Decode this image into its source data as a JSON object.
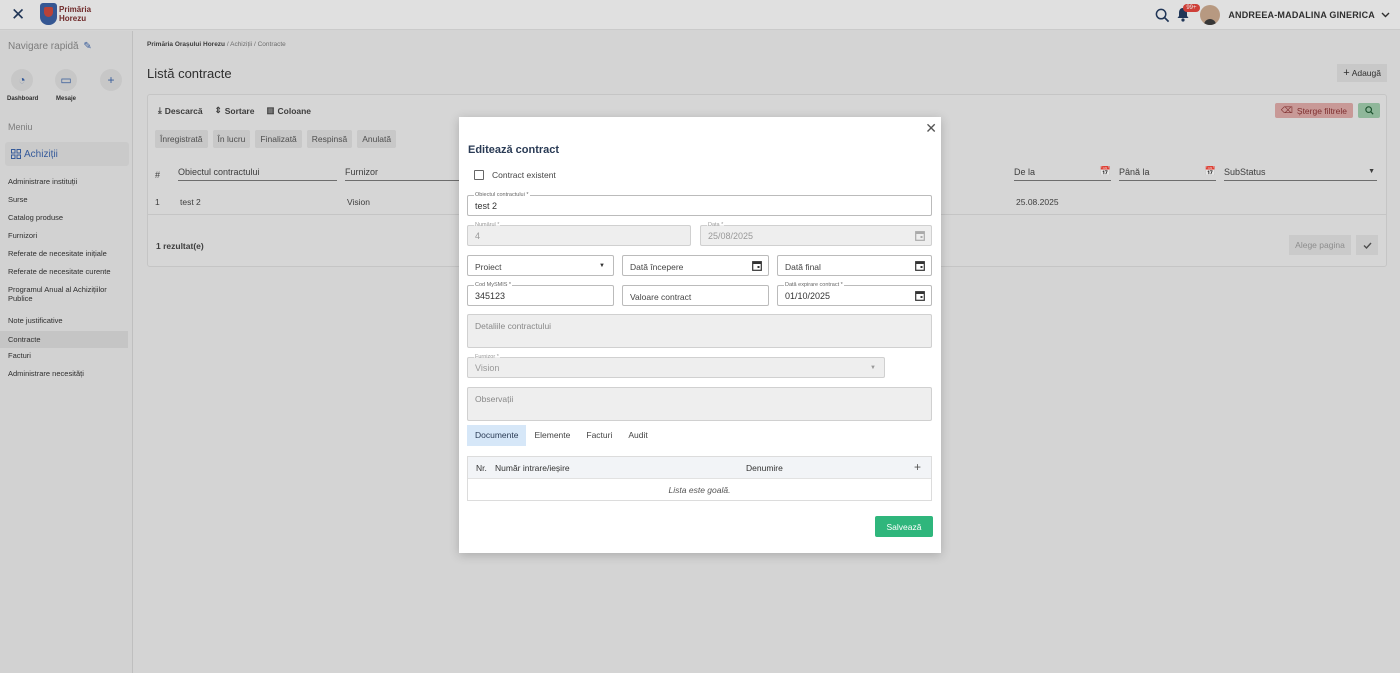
{
  "header": {
    "logo_text_1": "Primăria",
    "logo_text_2": "Horezu",
    "notifications_badge": "99+",
    "username": "ANDREEA-MADALINA GINERICA"
  },
  "sidebar": {
    "quick_nav_label": "Navigare rapidă",
    "quick_items": [
      {
        "label": "Dashboard"
      },
      {
        "label": "Mesaje"
      },
      {
        "label": ""
      }
    ],
    "menu_label": "Meniu",
    "section_label": "Achiziții",
    "items": [
      {
        "label": "Administrare instituții"
      },
      {
        "label": "Surse"
      },
      {
        "label": "Catalog produse"
      },
      {
        "label": "Furnizori"
      },
      {
        "label": "Referate de necesitate inițiale"
      },
      {
        "label": "Referate de necesitate curente"
      },
      {
        "label": "Programul Anual al Achizițiilor Publice"
      },
      {
        "label": "Note justificative"
      },
      {
        "label": "Contracte"
      },
      {
        "label": "Facturi"
      },
      {
        "label": "Administrare necesități"
      }
    ]
  },
  "breadcrumb": {
    "root": "Primăria Orașului Horezu",
    "sep": "/",
    "level2": "Achiziții",
    "level3": "Contracte"
  },
  "page": {
    "title": "Listă contracte",
    "add_label": "Adaugă"
  },
  "toolbar": {
    "download": "Descarcă",
    "sort": "Sortare",
    "columns": "Coloane",
    "clear_filters": "Șterge filtrele"
  },
  "status_chips": [
    "Înregistrată",
    "În lucru",
    "Finalizată",
    "Respinsă",
    "Anulată"
  ],
  "grid": {
    "headers": {
      "num": "#",
      "object": "Obiectul contractului",
      "supplier": "Furnizor",
      "from": "De la",
      "to": "Până la",
      "substatus": "SubStatus"
    },
    "row": {
      "num": "1",
      "object": "test 2",
      "supplier": "Vision",
      "date": "25.08.2025"
    },
    "results": "1 rezultat(e)",
    "pick_page": "Alege pagina"
  },
  "modal": {
    "title": "Editează contract",
    "existing_contract_label": "Contract existent",
    "object_label": "Obiectul contractului *",
    "object_value": "test 2",
    "number_label": "Numărul *",
    "number_value": "4",
    "date_label": "Data *",
    "date_value": "25/08/2025",
    "type_value": "Proiect",
    "start_placeholder": "Dată începere",
    "end_placeholder": "Dată final",
    "mysmis_label": "Cod MySMIS *",
    "mysmis_value": "345123",
    "value_placeholder": "Valoare contract",
    "expiry_label": "Dată expirare contract *",
    "expiry_value": "01/10/2025",
    "details_placeholder": "Detaliile contractului",
    "supplier_label": "Furnizor *",
    "supplier_value": "Vision",
    "observations_placeholder": "Observații",
    "tabs": [
      {
        "label": "Documente"
      },
      {
        "label": "Elemente"
      },
      {
        "label": "Facturi"
      },
      {
        "label": "Audit"
      }
    ],
    "doc_table": {
      "col_nr": "Nr.",
      "col_number": "Număr intrare/ieșire",
      "col_name": "Denumire",
      "empty": "Lista este goală."
    },
    "save_label": "Salvează"
  }
}
